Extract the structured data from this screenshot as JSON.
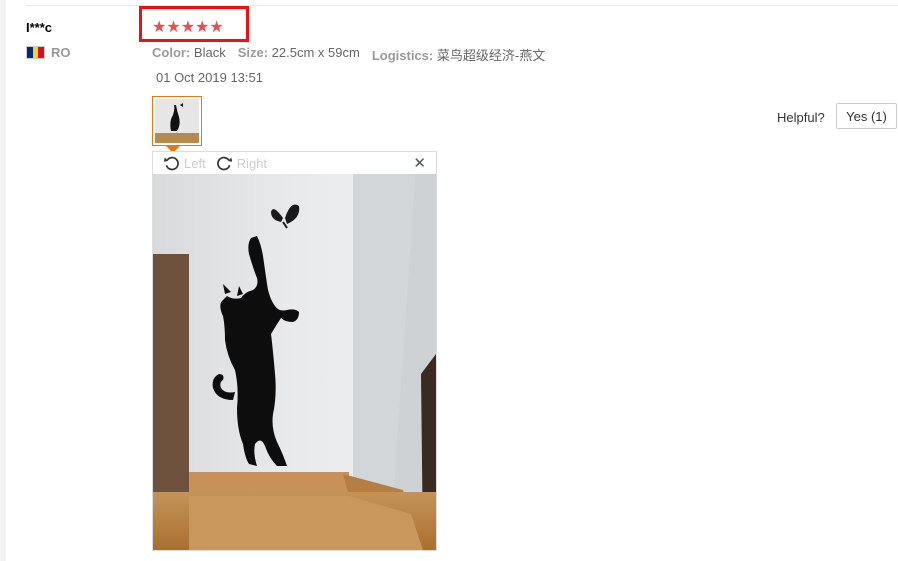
{
  "review": {
    "username": "I***c",
    "country_code": "RO",
    "rating_stars": "★★★★★",
    "rating_value": 5,
    "attributes": [
      {
        "label": "Color:",
        "value": "Black"
      },
      {
        "label": "Size:",
        "value": "22.5cm x 59cm"
      },
      {
        "label": "Logistics:",
        "value": "菜鸟超级经济-燕文"
      }
    ],
    "date": "01 Oct 2019 13:51"
  },
  "feedback": {
    "helpful_label": "Helpful?",
    "yes_label": "Yes (1)"
  },
  "viewer": {
    "rotate_left_label": "Left",
    "rotate_right_label": "Right",
    "close_glyph": "✕"
  },
  "colors": {
    "star": "#e94d4d",
    "highlight_border": "#e11111",
    "thumb_border": "#e37818",
    "flag": [
      "#002b7f",
      "#fcd116",
      "#ce1126"
    ]
  }
}
